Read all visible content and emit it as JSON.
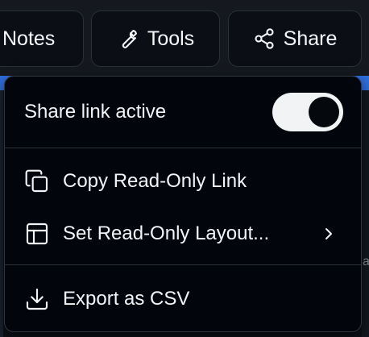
{
  "toolbar": {
    "notes_label": "Notes",
    "tools_label": "Tools",
    "share_label": "Share",
    "icons": {
      "tools": "wrench-icon",
      "share": "share-nodes-icon"
    }
  },
  "share_menu": {
    "toggle": {
      "label": "Share link active",
      "on": true
    },
    "items": [
      {
        "label": "Copy Read-Only Link",
        "icon": "copy-icon"
      },
      {
        "label": "Set Read-Only Layout...",
        "icon": "layout-icon",
        "submenu": true
      },
      {
        "label": "Export as CSV",
        "icon": "download-icon"
      }
    ]
  },
  "background": {
    "right_fragment": "a"
  },
  "colors": {
    "menu_bg": "#02050b",
    "toolbar_bg": "#15191f",
    "button_bg": "#0b0f15",
    "accent_blue": "#2f6fe0",
    "text": "#f2f4f7"
  }
}
